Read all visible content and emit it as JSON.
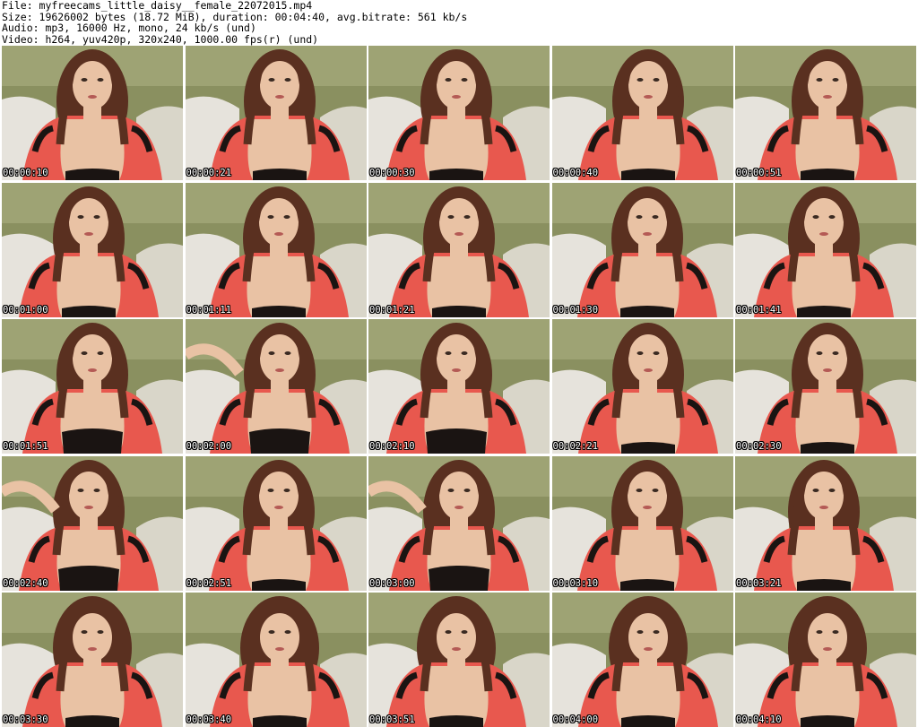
{
  "info": {
    "file": "File: myfreecams_little_daisy__female_22072015.mp4",
    "size": "Size: 19626002 bytes (18.72 MiB), duration: 00:04:40, avg.bitrate: 561 kb/s",
    "audio": "Audio: mp3, 16000 Hz, mono, 24 kb/s (und)",
    "video": "Video: h264, yuv420p, 320x240, 1000.00 fps(r) (und)"
  },
  "frames": [
    {
      "timestamp": "00:00:10",
      "variant": "a"
    },
    {
      "timestamp": "00:00:21",
      "variant": "a"
    },
    {
      "timestamp": "00:00:30",
      "variant": "b"
    },
    {
      "timestamp": "00:00:40",
      "variant": "a"
    },
    {
      "timestamp": "00:00:51",
      "variant": "a"
    },
    {
      "timestamp": "00:01:00",
      "variant": "a"
    },
    {
      "timestamp": "00:01:11",
      "variant": "a"
    },
    {
      "timestamp": "00:01:21",
      "variant": "a"
    },
    {
      "timestamp": "00:01:30",
      "variant": "a"
    },
    {
      "timestamp": "00:01:41",
      "variant": "a"
    },
    {
      "timestamp": "00:01:51",
      "variant": "c"
    },
    {
      "timestamp": "00:02:00",
      "variant": "d"
    },
    {
      "timestamp": "00:02:10",
      "variant": "d"
    },
    {
      "timestamp": "00:02:21",
      "variant": "a"
    },
    {
      "timestamp": "00:02:30",
      "variant": "a"
    },
    {
      "timestamp": "00:02:40",
      "variant": "d"
    },
    {
      "timestamp": "00:02:51",
      "variant": "a"
    },
    {
      "timestamp": "00:03:00",
      "variant": "d"
    },
    {
      "timestamp": "00:03:10",
      "variant": "a"
    },
    {
      "timestamp": "00:03:21",
      "variant": "a"
    },
    {
      "timestamp": "00:03:30",
      "variant": "e"
    },
    {
      "timestamp": "00:03:40",
      "variant": "e"
    },
    {
      "timestamp": "00:03:51",
      "variant": "e"
    },
    {
      "timestamp": "00:04:00",
      "variant": "e"
    },
    {
      "timestamp": "00:04:10",
      "variant": "e"
    }
  ],
  "colors": {
    "background": "#ffffff",
    "couch": "#8a9060",
    "couch_light": "#a7ab7e",
    "wall_cushion": "#e6e3dc",
    "robe": "#e8584e",
    "lace": "#1a1412",
    "hair": "#5a3020",
    "skin": "#e9c2a4",
    "timestamp_text": "#ffffff"
  }
}
